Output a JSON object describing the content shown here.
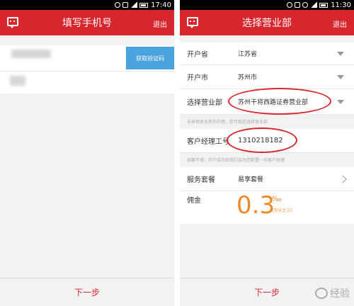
{
  "left": {
    "status_time": "17:40",
    "title": "填写手机号",
    "exit": "退出",
    "get_code": "获取验证码",
    "next": "下一步"
  },
  "right": {
    "status_time": "11:30",
    "title": "选择营业部",
    "exit": "退出",
    "rows": [
      {
        "label": "开户省",
        "value": "江苏省"
      },
      {
        "label": "开户市",
        "value": "苏州市"
      },
      {
        "label": "选择营业部",
        "value": "苏州干将西路证券营业部"
      }
    ],
    "branch_hint": "未来相关业务的办理，您可就近选择营业部",
    "manager_label": "客户经理工号",
    "manager_value": "1310218182",
    "manager_hint": "如果不填，开户成功后我们会为您配置一名客户经理",
    "service_label": "服务套餐",
    "service_value": "易享套餐",
    "commission_label": "佣金",
    "commission_value": "0.3",
    "commission_unit": "‰",
    "commission_sub": "(万分之三)",
    "next": "下一步",
    "watermark": "经验"
  }
}
